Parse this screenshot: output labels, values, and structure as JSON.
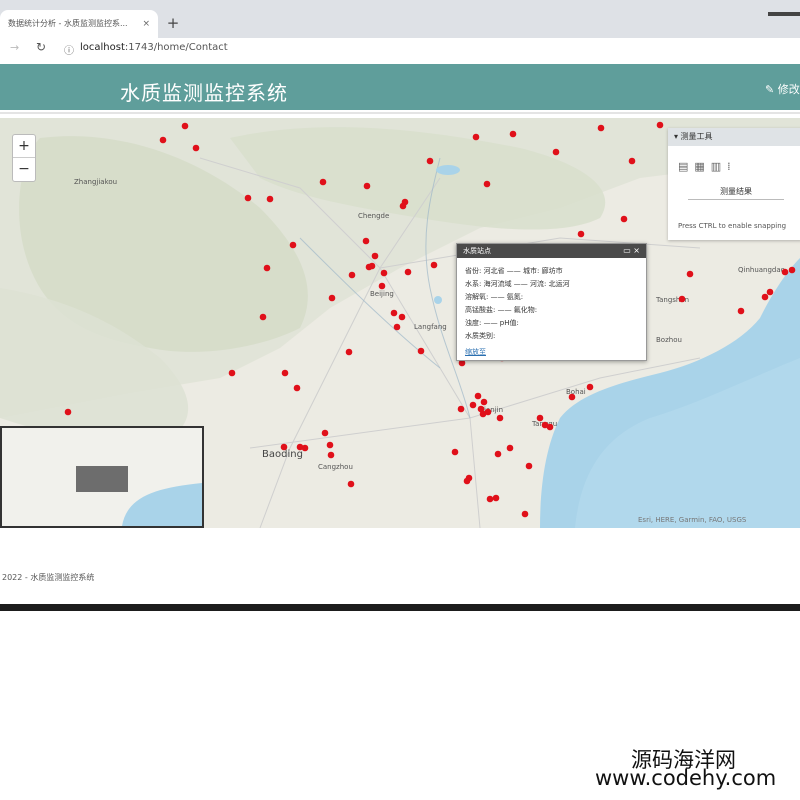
{
  "browser": {
    "tab_title": "数据统计分析 - 水质监测监控系...",
    "tab_close": "×",
    "new_tab": "+",
    "url_host": "localhost",
    "url_rest": ":1743/home/Contact"
  },
  "header": {
    "title": "水质监测监控系统",
    "edit_label": "✎ 修改"
  },
  "map": {
    "zoom_in": "+",
    "zoom_out": "−",
    "labels": [
      {
        "text": "Tianjin"
      },
      {
        "text": "Baoding"
      },
      {
        "text": "Langfang"
      },
      {
        "text": "Tangshan"
      },
      {
        "text": "Chengde"
      },
      {
        "text": "Zhangjiakou"
      },
      {
        "text": "Qinhuangdao"
      },
      {
        "text": "Beijing"
      },
      {
        "text": "Cangzhou"
      },
      {
        "text": "Bohai"
      },
      {
        "text": "Tanggu"
      },
      {
        "text": "Bozhou"
      }
    ],
    "measure": {
      "title": "▾ 测量工具",
      "result": "测量结果",
      "hint": "Press CTRL to enable snapping"
    },
    "popup": {
      "title": "水质站点",
      "lines": [
        "省份: 河北省 —— 城市: 廊坊市",
        "水系: 海河流域 —— 河流: 北运河",
        "溶解氧: —— 氨氮:",
        "高锰酸盐: —— 氟化物:",
        "浊度: —— pH值:",
        "水质类别:"
      ],
      "zoom_link": "缩放至"
    },
    "attribution": "Esri, HERE, Garmin, FAO, USGS",
    "markers_color": "#e0101a"
  },
  "footer": {
    "text": "2022 - 水质监测监控系统"
  },
  "watermark": {
    "line1": "源码海洋网",
    "line2": "www.codehy.com"
  }
}
